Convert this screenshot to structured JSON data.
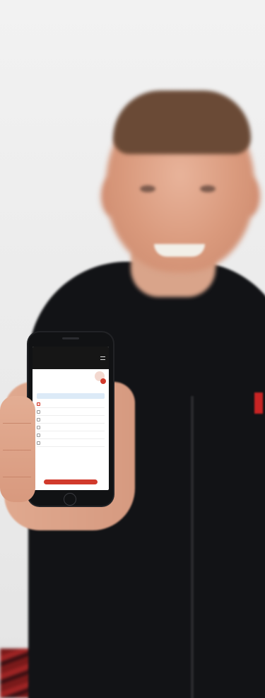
{
  "phone_screen": {
    "status_left": "",
    "status_time": "",
    "status_right": "",
    "brand": "",
    "brand_sub": "",
    "profile": {
      "name": "",
      "title": "",
      "email": "",
      "phone": ""
    },
    "tab_label": "",
    "menu_items": [
      {
        "label": ""
      },
      {
        "label": ""
      },
      {
        "label": ""
      },
      {
        "label": ""
      },
      {
        "label": ""
      },
      {
        "label": ""
      }
    ],
    "cta_label": ""
  },
  "colors": {
    "accent": "#d13a2c",
    "jacket": "#121316",
    "background": "#ececec"
  }
}
